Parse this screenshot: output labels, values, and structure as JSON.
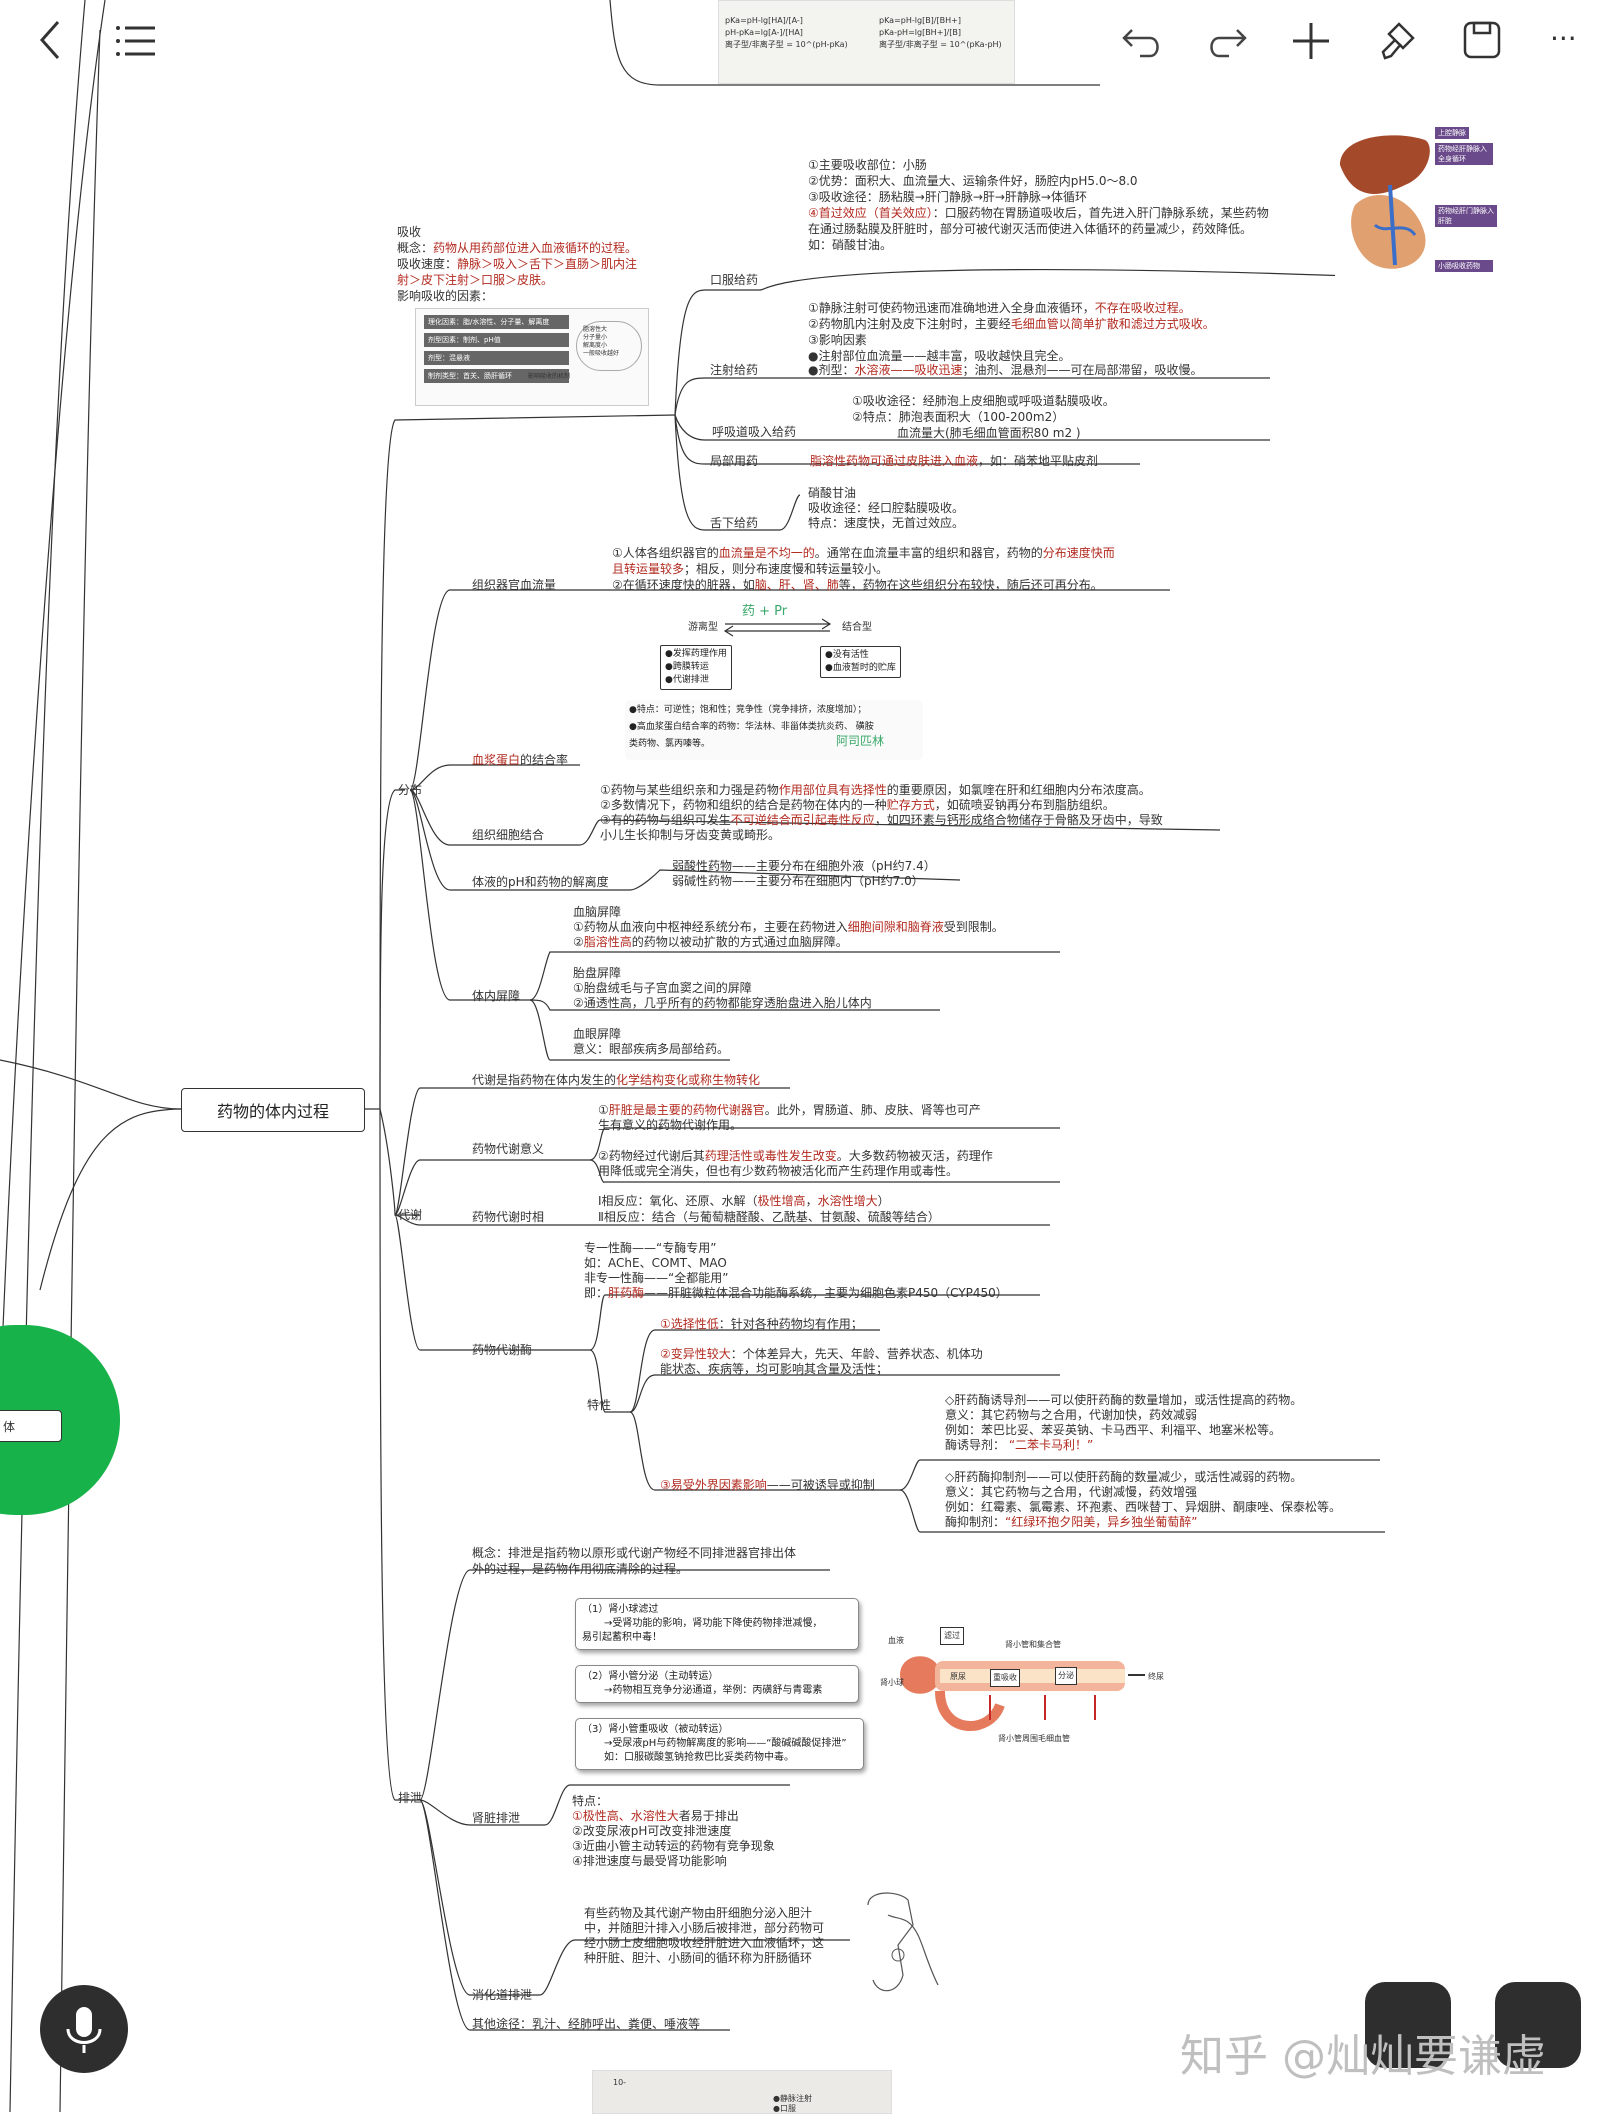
{
  "toolbar": {
    "back_icon": "chevron-left-icon",
    "menu_icon": "menu-icon",
    "undo_icon": "undo-icon",
    "redo_icon": "redo-icon",
    "add_icon": "plus-icon",
    "format_icon": "format-brush-icon",
    "save_icon": "save-icon",
    "more_label": "···"
  },
  "central_node": "药物的体内过程",
  "left_node_label": "体",
  "watermark": "知乎 @灿灿要谦虚",
  "absorption": {
    "title": "吸收",
    "concept_prefix": "概念：",
    "concept": "药物从用药部位进入血液循环的过程。",
    "speed_prefix": "吸收速度：",
    "speed_red": "静脉＞吸入＞舌下＞直肠＞肌内注",
    "speed_red2": "射＞皮下注射＞口服＞皮肤。",
    "factors": "影响吸收的因素：",
    "fig_rows": [
      "理化因素：脂/水溶性、分子量、解离度",
      "剂型因素：制剂、pH值",
      "剂型：混悬液",
      "制剂类型：首关、肠肝循环"
    ],
    "fig_cloud": [
      "脂溶性大",
      "分子量小",
      "解离度小",
      "一般吸收越好"
    ],
    "fig_note": "影响吸收的机制"
  },
  "routes": {
    "oral": {
      "label": "口服给药",
      "l1": "①主要吸收部位：小肠",
      "l2": "②优势：面积大、血流量大、运输条件好，肠腔内pH5.0～8.0",
      "l3": "③吸收途径：肠粘膜→肝门静脉→肝→肝静脉→体循环",
      "l4a": "④首过效应（首关效应）",
      "l4b": "：口服药物在胃肠道吸收后，首先进入肝门静脉系统，某些药物",
      "l5": "在通过肠黏膜及肝脏时，部分可被代谢灭活而使进入体循环的药量减少，药效降低。",
      "l6": "如：硝酸甘油。",
      "fig_labels": [
        "上腔静脉",
        "药物经肝静脉入全身循环",
        "药物经肝门静脉入肝脏",
        "小肠吸收药物"
      ]
    },
    "injection": {
      "label": "注射给药",
      "l1a": "①静脉注射可使药物迅速而准确地进入全身血液循环，",
      "l1b": "不存在吸收过程。",
      "l2a": "②药物肌内注射及皮下注射时，主要经",
      "l2b": "毛细血管以简单扩散和滤过方式吸收。",
      "l3": "③影响因素",
      "l4": "●注射部位血流量——越丰富，吸收越快且完全。",
      "l5a": "●剂型：",
      "l5b": "水溶液——吸收迅速",
      "l5c": "；油剂、混悬剂——可在局部滞留，吸收慢。"
    },
    "inhalation": {
      "label": "呼吸道吸入给药",
      "l1": "①吸收途径：经肺泡上皮细胞或呼吸道黏膜吸收。",
      "l2": "②特点：肺泡表面积大（100-200m2）",
      "l3": "血流量大(肺毛细血管面积80 m2 )"
    },
    "topical": {
      "label": "局部用药",
      "red": "脂溶性药物可通过皮肤进入血液",
      "rest": "，如：硝苯地平贴皮剂"
    },
    "sublingual": {
      "label": "舌下给药",
      "l1": "硝酸甘油",
      "l2": "吸收途径：经口腔黏膜吸收。",
      "l3": "特点：速度快，无首过效应。"
    }
  },
  "distribution": {
    "label": "分布",
    "blood_flow": {
      "label": "组织器官血流量",
      "l1a": "①人体各组织器官的",
      "l1b": "血流量是不均一的",
      "l1c": "。通常在血流量丰富的组织和器官，药物的",
      "l1d": "分布速度快而",
      "l2a": "且转运量较多",
      "l2b": "；相反，则分布速度慢和转运量较小。",
      "l3a": "②在循环速度快的脏器，如",
      "l3b": "脑、肝、肾、肺",
      "l3c": "等，药物在这些组织分布较快，随后还可再分布。"
    },
    "plasma": {
      "label_red": "血浆蛋白",
      "label_rest": "的结合率",
      "free": "游离型",
      "bound": "结合型",
      "handwritten1": "药 + Pr",
      "free_box": [
        "●发挥药理作用",
        "●跨膜转运",
        "●代谢排泄"
      ],
      "bound_box": [
        "●没有活性",
        "●血液暂时的贮库"
      ],
      "note1": "●特点：可逆性；饱和性；竞争性（竞争排挤，浓度增加）；",
      "note2": "●高血浆蛋白结合率的药物：华法林、非甾体类抗炎药、  磺胺",
      "note3": "类药物、氯丙嗪等。",
      "handwritten2": "阿司匹林"
    },
    "tissue": {
      "label": "组织细胞结合",
      "l1a": "①药物与某些组织亲和力强是药物",
      "l1b": "作用部位具有选择性",
      "l1c": "的重要原因，如氯喹在肝和红细胞内分布浓度高。",
      "l2a": "②多数情况下，药物和组织的结合是药物在体内的一种",
      "l2b": "贮存方式",
      "l2c": "，如硫喷妥钠再分布到脂肪组织。",
      "l3a": "③有的药物与组织可发生",
      "l3b": "不可逆结合而引起毒性反应",
      "l3c": "，如四环素与钙形成络合物储存于骨骼及牙齿中，导致",
      "l4": "小儿生长抑制与牙齿变黄或畸形。"
    },
    "ph": {
      "label": "体液的pH和药物的解离度",
      "l1": "弱酸性药物——主要分布在细胞外液（pH约7.4）",
      "l2": "弱碱性药物——主要分布在细胞内（pH约7.0）"
    },
    "barrier": {
      "label": "体内屏障",
      "bbb": "血脑屏障",
      "bbb1a": "①药物从血液向中枢神经系统分布，主要在药物进入",
      "bbb1b": "细胞间隙和脑脊液",
      "bbb1c": "受到限制。",
      "bbb2a": "②",
      "bbb2b": "脂溶性高",
      "bbb2c": "的药物以被动扩散的方式通过血脑屏障。",
      "placenta": "胎盘屏障",
      "pl1": "①胎盘绒毛与子宫血窦之间的屏障",
      "pl2": "②通透性高，几乎所有的药物都能穿透胎盘进入胎儿体内",
      "eye": "血眼屏障",
      "eye1": "意义：眼部疾病多局部给药。"
    }
  },
  "metabolism": {
    "label": "代谢",
    "def_a": "代谢是指药物在体内发生的",
    "def_b": "化学结构变化或称生物转化",
    "meaning": {
      "label": "药物代谢意义",
      "l1a": "①",
      "l1b": "肝脏是最主要的药物代谢器官",
      "l1c": "。此外，胃肠道、肺、皮肤、肾等也可产",
      "l2": "生有意义的药物代谢作用。",
      "l3a": "②药物经过代谢后其",
      "l3b": "药理活性或毒性发生改变",
      "l3c": "。大多数药物被灭活，药理作",
      "l4": "用降低或完全消失，但也有少数药物被活化而产生药理作用或毒性。"
    },
    "phase": {
      "label": "药物代谢时相",
      "l1a": "Ⅰ相反应：氧化、还原、水解（",
      "l1b": "极性增高",
      "l1c": "，",
      "l1d": "水溶性增大",
      "l1e": "）",
      "l2": "Ⅱ相反应：结合（与葡萄糖醛酸、乙酰基、甘氨酸、硫酸等结合）"
    },
    "enzyme": {
      "label": "药物代谢酶",
      "l1": "专一性酶——“专酶专用”",
      "l2": "如：AChE、COMT、MAO",
      "l3": "非专一性酶——“全都能用”",
      "l4a": "即：",
      "l4b": "肝药酶",
      "l4c": "——肝脏微粒体混合功能酶系统，主要为细胞色素P450（CYP450）",
      "trait_label": "特性",
      "t1a": "①",
      "t1b": "选择性低",
      "t1c": "：针对各种药物均有作用；",
      "t2a": "②",
      "t2b": "变异性较大",
      "t2c": "：个体差异大，先天、年龄、营养状态、机体功",
      "t2d": "能状态、疾病等，均可影响其含量及活性；",
      "t3a": "③",
      "t3b": "易受外界因素影响",
      "t3c": "——可被诱导或抑制",
      "ind1": "◇肝药酶诱导剂——可以使肝药酶的数量增加，或活性提高的药物。",
      "ind2": "意义：其它药物与之合用，代谢加快，药效减弱",
      "ind3": "例如：苯巴比妥、苯妥英钠、卡马西平、利福平、地塞米松等。",
      "ind4a": "酶诱导剂：  ",
      "ind4b": "“二苯卡马利！”",
      "inh1": "◇肝药酶抑制剂——可以使肝药酶的数量减少，或活性减弱的药物。",
      "inh2": "意义：其它药物与之合用，代谢减慢，药效增强",
      "inh3": "例如：红霉素、氯霉素、环孢素、西咪替丁、异烟肼、酮康唑、保泰松等。",
      "inh4a": "酶抑制剂：",
      "inh4b": "“红绿环抱夕阳美，异乡独坐葡萄醉”"
    }
  },
  "excretion": {
    "label": "排泄",
    "concept1": "概念：排泄是指药物以原形或代谢产物经不同排泄器官排出体",
    "concept2": "外的过程，是药物作用彻底清除的过程。",
    "card1": [
      "（1）肾小球滤过",
      "→受肾功能的影响，肾功能下降使药物排泄减慢，",
      "易引起蓄积中毒！"
    ],
    "card2": [
      "（2）肾小管分泌（主动转运）",
      "→药物相互竞争分泌通道，举例：丙磺舒与青霉素"
    ],
    "card3": [
      "（3）肾小管重吸收（被动转运）",
      "→受尿液pH与药物解离度的影响——“酸碱碱酸促排泄”",
      "如：口服碳酸氢钠抢救巴比妥类药物中毒。"
    ],
    "kidney_fig": {
      "blood": "血液",
      "filter": "滤过",
      "tubule_title": "肾小管和集合管",
      "capsule": "肾小球",
      "urine_src": "原尿",
      "reabsorb": "重吸收",
      "secrete": "分泌",
      "final_urine": "终尿",
      "capillary": "肾小管周围毛细血管"
    },
    "kidney": {
      "label": "肾脏排泄",
      "h": "特点：",
      "l1a": "①",
      "l1b": "极性高、水溶性大",
      "l1c": "者易于排出",
      "l2": "②改变尿液pH可改变排泄速度",
      "l3": "③近曲小管主动转运的药物有竞争现象",
      "l4": "④排泄速度与最受肾功能影响"
    },
    "digestive": {
      "label": "消化道排泄",
      "l1": "有些药物及其代谢产物由肝细胞分泌入胆汁",
      "l2": "中，并随胆汁排入小肠后被排泄，部分药物可",
      "l3": "经小肠上皮细胞吸收经肝脏进入血液循环，这",
      "l4": "种肝脏、胆汁、小肠间的循环称为肝肠循环"
    },
    "other": "其他途径：乳汁、经肺呼出、粪便、唾液等"
  },
  "top_fig": {
    "left": [
      "pKa=pH-lg[HA]/[A-]",
      "pH-pKa=lg[A-]/[HA]",
      "离子型/非离子型 = 10^(pH-pKa)"
    ],
    "right": [
      "pKa=pH-lg[B]/[BH+]",
      "pKa-pH=lg[BH+]/[B]",
      "离子型/非离子型 = 10^(pKa-pH)"
    ]
  },
  "bottom_fig": {
    "tick": "10-",
    "legend1": "●静脉注射",
    "legend2": "●口服"
  }
}
